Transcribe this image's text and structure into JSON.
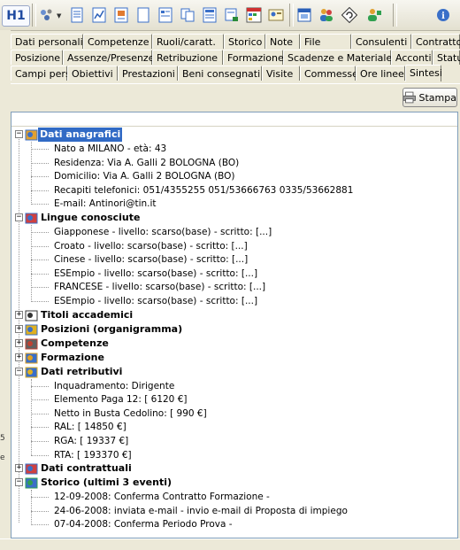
{
  "app": {
    "logo": "H1"
  },
  "toolbar": {
    "icons": [
      "tools-dropdown-icon",
      "document-icon",
      "chart-icon",
      "report-icon",
      "page-icon",
      "form-icon",
      "tree-copy-icon",
      "list-icon",
      "print-preview-icon",
      "calendar-grid-icon",
      "user-card-icon",
      "window-icon",
      "users-icon",
      "refresh-icon",
      "user-add-icon",
      "info-icon"
    ]
  },
  "tabs": {
    "row1": [
      "Dati personali",
      "Competenze",
      "Ruoli/caratt.",
      "Storico",
      "Note",
      "File",
      "Consulenti",
      "Contratto"
    ],
    "row2": [
      "Posizione",
      "Assenze/Presenze",
      "Retribuzione",
      "Formazione",
      "Scadenze e Materiale",
      "Acconti",
      "Status"
    ],
    "row3": [
      "Campi pers.",
      "Obiettivi",
      "Prestazioni",
      "Beni consegnati",
      "Visite",
      "Commesse",
      "Ore linee",
      "Sintesi"
    ],
    "active": "Sintesi"
  },
  "print_button": {
    "label": "Stampa"
  },
  "tree": {
    "sections": [
      {
        "label": "Dati anagrafici",
        "expanded": true,
        "selected": true,
        "items": [
          "Nato a MILANO - età: 43",
          "Residenza: Via A. Galli 2  BOLOGNA (BO)",
          "Domicilio: Via A. Galli 2  BOLOGNA (BO)",
          "Recapiti telefonici: 051/4355255  051/53666763 0335/53662881",
          "E-mail: Antinori@tin.it"
        ]
      },
      {
        "label": "Lingue conosciute",
        "expanded": true,
        "items": [
          "Giapponese - livello: scarso(base) - scritto: [...]",
          "Croato - livello: scarso(base) - scritto: [...]",
          "Cinese - livello: scarso(base) - scritto: [...]",
          "ESEmpio - livello: scarso(base) - scritto: [...]",
          "FRANCESE - livello: scarso(base) - scritto: [...]",
          "ESEmpio - livello: scarso(base) - scritto: [...]"
        ]
      },
      {
        "label": "Titoli accademici",
        "expanded": false,
        "items": []
      },
      {
        "label": "Posizioni (organigramma)",
        "expanded": false,
        "items": []
      },
      {
        "label": "Competenze",
        "expanded": false,
        "items": []
      },
      {
        "label": "Formazione",
        "expanded": false,
        "items": []
      },
      {
        "label": "Dati retributivi",
        "expanded": true,
        "items": [
          "Inquadramento: Dirigente",
          "Elemento Paga 12: [ 6120 €]",
          "Netto in Busta Cedolino: [ 990 €]",
          "RAL: [ 14850 €]",
          "RGA: [ 19337 €]",
          "RTA: [ 193370 €]"
        ]
      },
      {
        "label": "Dati contrattuali",
        "expanded": false,
        "items": []
      },
      {
        "label": "Storico (ultimi 3 eventi)",
        "expanded": true,
        "items": [
          "12-09-2008: Conferma Contratto Formazione -",
          "24-06-2008: inviata e-mail - invio e-mail di Proposta di impiego",
          "07-04-2008: Conferma Periodo Prova -"
        ]
      }
    ]
  },
  "left_edge_marks": [
    "5",
    "e"
  ]
}
